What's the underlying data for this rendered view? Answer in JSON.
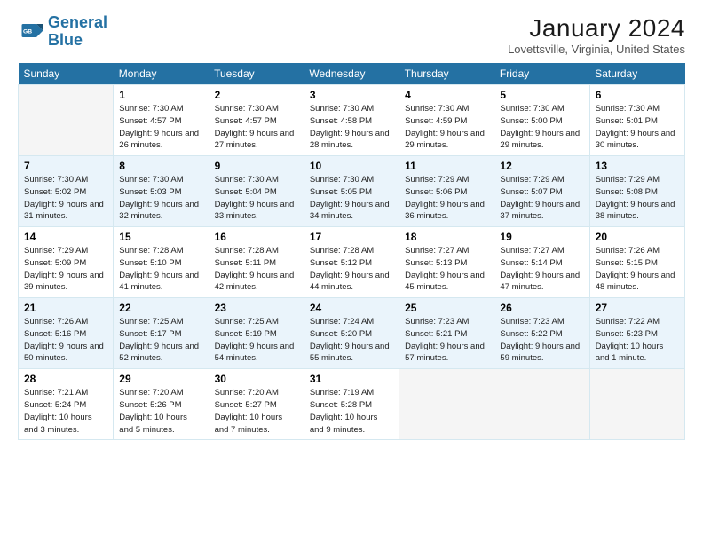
{
  "logo": {
    "line1": "General",
    "line2": "Blue"
  },
  "title": "January 2024",
  "subtitle": "Lovettsville, Virginia, United States",
  "days_of_week": [
    "Sunday",
    "Monday",
    "Tuesday",
    "Wednesday",
    "Thursday",
    "Friday",
    "Saturday"
  ],
  "weeks": [
    [
      {
        "day": "",
        "content": ""
      },
      {
        "day": "1",
        "content": "Sunrise: 7:30 AM\nSunset: 4:57 PM\nDaylight: 9 hours and 26 minutes."
      },
      {
        "day": "2",
        "content": "Sunrise: 7:30 AM\nSunset: 4:57 PM\nDaylight: 9 hours and 27 minutes."
      },
      {
        "day": "3",
        "content": "Sunrise: 7:30 AM\nSunset: 4:58 PM\nDaylight: 9 hours and 28 minutes."
      },
      {
        "day": "4",
        "content": "Sunrise: 7:30 AM\nSunset: 4:59 PM\nDaylight: 9 hours and 29 minutes."
      },
      {
        "day": "5",
        "content": "Sunrise: 7:30 AM\nSunset: 5:00 PM\nDaylight: 9 hours and 29 minutes."
      },
      {
        "day": "6",
        "content": "Sunrise: 7:30 AM\nSunset: 5:01 PM\nDaylight: 9 hours and 30 minutes."
      }
    ],
    [
      {
        "day": "7",
        "content": "Sunrise: 7:30 AM\nSunset: 5:02 PM\nDaylight: 9 hours and 31 minutes."
      },
      {
        "day": "8",
        "content": "Sunrise: 7:30 AM\nSunset: 5:03 PM\nDaylight: 9 hours and 32 minutes."
      },
      {
        "day": "9",
        "content": "Sunrise: 7:30 AM\nSunset: 5:04 PM\nDaylight: 9 hours and 33 minutes."
      },
      {
        "day": "10",
        "content": "Sunrise: 7:30 AM\nSunset: 5:05 PM\nDaylight: 9 hours and 34 minutes."
      },
      {
        "day": "11",
        "content": "Sunrise: 7:29 AM\nSunset: 5:06 PM\nDaylight: 9 hours and 36 minutes."
      },
      {
        "day": "12",
        "content": "Sunrise: 7:29 AM\nSunset: 5:07 PM\nDaylight: 9 hours and 37 minutes."
      },
      {
        "day": "13",
        "content": "Sunrise: 7:29 AM\nSunset: 5:08 PM\nDaylight: 9 hours and 38 minutes."
      }
    ],
    [
      {
        "day": "14",
        "content": "Sunrise: 7:29 AM\nSunset: 5:09 PM\nDaylight: 9 hours and 39 minutes."
      },
      {
        "day": "15",
        "content": "Sunrise: 7:28 AM\nSunset: 5:10 PM\nDaylight: 9 hours and 41 minutes."
      },
      {
        "day": "16",
        "content": "Sunrise: 7:28 AM\nSunset: 5:11 PM\nDaylight: 9 hours and 42 minutes."
      },
      {
        "day": "17",
        "content": "Sunrise: 7:28 AM\nSunset: 5:12 PM\nDaylight: 9 hours and 44 minutes."
      },
      {
        "day": "18",
        "content": "Sunrise: 7:27 AM\nSunset: 5:13 PM\nDaylight: 9 hours and 45 minutes."
      },
      {
        "day": "19",
        "content": "Sunrise: 7:27 AM\nSunset: 5:14 PM\nDaylight: 9 hours and 47 minutes."
      },
      {
        "day": "20",
        "content": "Sunrise: 7:26 AM\nSunset: 5:15 PM\nDaylight: 9 hours and 48 minutes."
      }
    ],
    [
      {
        "day": "21",
        "content": "Sunrise: 7:26 AM\nSunset: 5:16 PM\nDaylight: 9 hours and 50 minutes."
      },
      {
        "day": "22",
        "content": "Sunrise: 7:25 AM\nSunset: 5:17 PM\nDaylight: 9 hours and 52 minutes."
      },
      {
        "day": "23",
        "content": "Sunrise: 7:25 AM\nSunset: 5:19 PM\nDaylight: 9 hours and 54 minutes."
      },
      {
        "day": "24",
        "content": "Sunrise: 7:24 AM\nSunset: 5:20 PM\nDaylight: 9 hours and 55 minutes."
      },
      {
        "day": "25",
        "content": "Sunrise: 7:23 AM\nSunset: 5:21 PM\nDaylight: 9 hours and 57 minutes."
      },
      {
        "day": "26",
        "content": "Sunrise: 7:23 AM\nSunset: 5:22 PM\nDaylight: 9 hours and 59 minutes."
      },
      {
        "day": "27",
        "content": "Sunrise: 7:22 AM\nSunset: 5:23 PM\nDaylight: 10 hours and 1 minute."
      }
    ],
    [
      {
        "day": "28",
        "content": "Sunrise: 7:21 AM\nSunset: 5:24 PM\nDaylight: 10 hours and 3 minutes."
      },
      {
        "day": "29",
        "content": "Sunrise: 7:20 AM\nSunset: 5:26 PM\nDaylight: 10 hours and 5 minutes."
      },
      {
        "day": "30",
        "content": "Sunrise: 7:20 AM\nSunset: 5:27 PM\nDaylight: 10 hours and 7 minutes."
      },
      {
        "day": "31",
        "content": "Sunrise: 7:19 AM\nSunset: 5:28 PM\nDaylight: 10 hours and 9 minutes."
      },
      {
        "day": "",
        "content": ""
      },
      {
        "day": "",
        "content": ""
      },
      {
        "day": "",
        "content": ""
      }
    ]
  ]
}
